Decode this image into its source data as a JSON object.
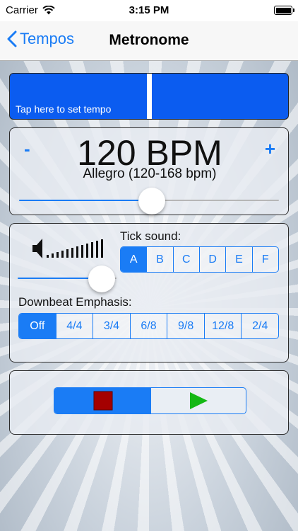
{
  "status_bar": {
    "carrier": "Carrier",
    "time": "3:15 PM",
    "icons": [
      "wifi-icon",
      "battery-icon"
    ]
  },
  "nav": {
    "back_label": "Tempos",
    "title": "Metronome",
    "back_icon": "chevron-left-icon"
  },
  "tap": {
    "label": "Tap here to set tempo",
    "color": "#0b5cf0"
  },
  "tempo": {
    "minus_label": "-",
    "plus_label": "+",
    "bpm_display": "120 BPM",
    "bpm": 120,
    "name": "Allegro (120-168 bpm)",
    "slider_fraction": 0.51
  },
  "sound": {
    "volume_fraction": 0.85,
    "tick_label": "Tick sound:",
    "tick_options": [
      "A",
      "B",
      "C",
      "D",
      "E",
      "F"
    ],
    "tick_selected": "A",
    "downbeat_label": "Downbeat Emphasis:",
    "downbeat_options": [
      "Off",
      "4/4",
      "3/4",
      "6/8",
      "9/8",
      "12/8",
      "2/4"
    ],
    "downbeat_selected": "Off"
  },
  "transport": {
    "stop_icon": "stop-icon",
    "play_icon": "play-icon",
    "stop_color": "#a40000",
    "play_color": "#14b814"
  },
  "colors": {
    "accent": "#1a7cf5",
    "tap_blue": "#0b5cf0"
  }
}
